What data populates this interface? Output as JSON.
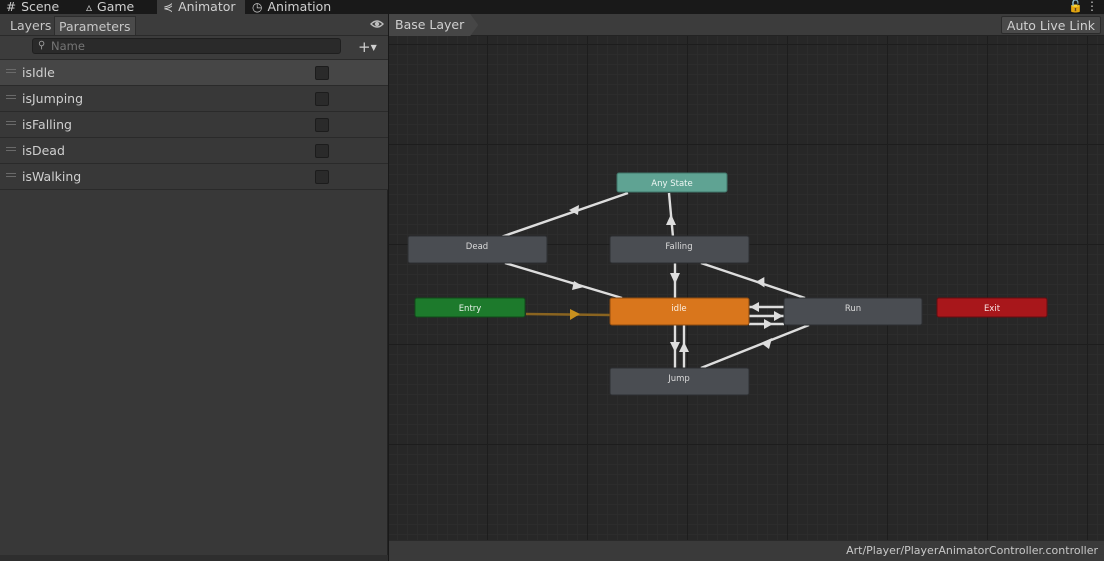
{
  "tabs": {
    "scene": {
      "label": "Scene",
      "icon": "grid-icon"
    },
    "game": {
      "label": "Game",
      "icon": "gamepad-icon"
    },
    "animator": {
      "label": "Animator",
      "icon": "animator-icon"
    },
    "animation": {
      "label": "Animation",
      "icon": "clock-icon"
    }
  },
  "left_panel": {
    "tabs": {
      "layers": "Layers",
      "parameters": "Parameters"
    },
    "search_placeholder": "Name",
    "parameters": [
      {
        "name": "isIdle",
        "checked": false
      },
      {
        "name": "isJumping",
        "checked": false
      },
      {
        "name": "isFalling",
        "checked": false
      },
      {
        "name": "isDead",
        "checked": false
      },
      {
        "name": "isWalking",
        "checked": false
      }
    ]
  },
  "graph": {
    "breadcrumb": "Base Layer",
    "auto_live_link": "Auto Live Link",
    "states": {
      "any_state": "Any State",
      "dead": "Dead",
      "falling": "Falling",
      "entry": "Entry",
      "idle": "idle",
      "run": "Run",
      "exit": "Exit",
      "jump": "Jump"
    },
    "colors": {
      "any_state": "#5fa393",
      "state": "#4a4d52",
      "entry": "#1d7a2c",
      "default_state": "#d9761c",
      "exit": "#a8171b",
      "transition": "#dddddd",
      "entry_transition": "#8a6420"
    }
  },
  "status": {
    "path": "Art/Player/PlayerAnimatorController.controller"
  }
}
